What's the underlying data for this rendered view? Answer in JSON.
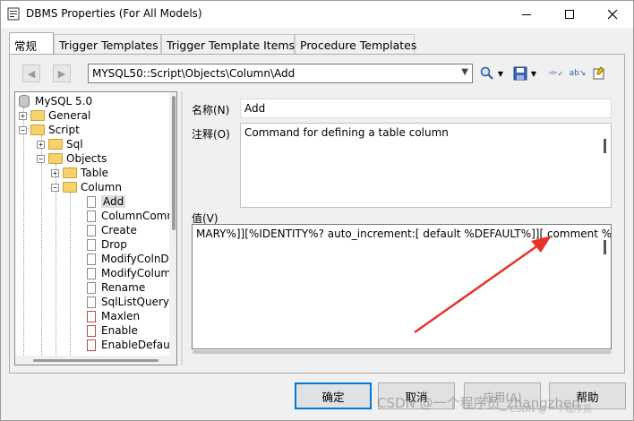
{
  "window": {
    "title": "DBMS Properties (For All Models)"
  },
  "tabs": [
    {
      "label": "常规",
      "active": true
    },
    {
      "label": "Trigger Templates",
      "active": false
    },
    {
      "label": "Trigger Template Items",
      "active": false
    },
    {
      "label": "Procedure Templates",
      "active": false
    }
  ],
  "toolbar": {
    "back_icon": "back-arrow-icon",
    "forward_icon": "forward-arrow-icon",
    "path": "MYSQL50::Script\\Objects\\Column\\Add"
  },
  "tree": {
    "root": "MySQL 5.0",
    "general": "General",
    "script": "Script",
    "sql": "Sql",
    "objects": "Objects",
    "table": "Table",
    "column": "Column",
    "column_items": [
      "Add",
      "ColumnComm",
      "Create",
      "Drop",
      "ModifyColnDf",
      "ModifyColumn",
      "Rename",
      "SqlListQuery",
      "Maxlen",
      "Enable",
      "EnableDefaul"
    ]
  },
  "form": {
    "name_label": "名称(N)",
    "name_value": "Add",
    "comment_label": "注释(O)",
    "comment_value": "Command for defining a table column",
    "value_label": "值(V)",
    "value_text": "MARY%]][%IDENTITY%? auto_increment:[ default %DEFAULT%]][ comment %.q:COMMENT%]"
  },
  "buttons": {
    "ok": "确定",
    "cancel": "取消",
    "apply": "应用(A)",
    "help": "帮助"
  },
  "watermark": {
    "main": "CSDN @一个程序员_zhangzhen",
    "sub": "CSDN @一个程序员"
  },
  "colors": {
    "accent": "#0078d7",
    "arrow": "#e8322a"
  }
}
